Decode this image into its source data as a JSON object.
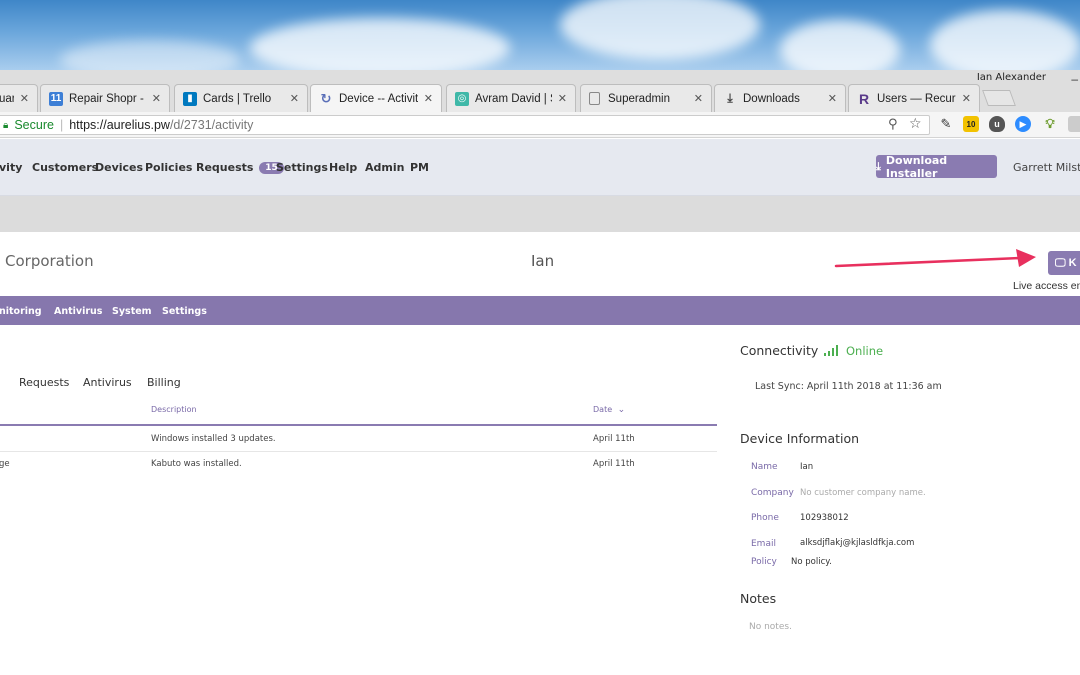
{
  "os": {
    "user_badge": "Ian Alexander",
    "minimize_glyph": "–"
  },
  "browser": {
    "tabs": [
      {
        "title": "uar",
        "icon": "generic-favicon"
      },
      {
        "title": "Repair Shopr - Cal",
        "icon": "calendar-icon"
      },
      {
        "title": "Cards | Trello",
        "icon": "trello-icon"
      },
      {
        "title": "Device -- Activity",
        "icon": "loading-icon"
      },
      {
        "title": "Avram David | Sync",
        "icon": "sync-icon"
      },
      {
        "title": "Superadmin",
        "icon": "document-icon"
      },
      {
        "title": "Downloads",
        "icon": "download-icon"
      },
      {
        "title": "Users — Recurly",
        "icon": "recurly-icon"
      }
    ],
    "address": {
      "secure_label": "Secure",
      "host": "https://aurelius.pw",
      "path": "/d/2731/activity"
    },
    "extension_badge": "10"
  },
  "header": {
    "nav": [
      "vity",
      "Customers",
      "Devices",
      "Policies",
      "Requests",
      "Settings",
      "Help",
      "Admin",
      "PM"
    ],
    "requests_count": "15",
    "download_button": "Download Installer",
    "user_name": "Garrett Milster"
  },
  "device": {
    "org": "Corporation",
    "name": "Ian",
    "remote_button": "K",
    "live_note": "Live access enc"
  },
  "subnav": [
    "nitoring",
    "Antivirus",
    "System",
    "Settings"
  ],
  "content": {
    "tabs": [
      "Requests",
      "Antivirus",
      "Billing"
    ],
    "columns": {
      "description": "Description",
      "date": "Date"
    },
    "rows": [
      {
        "type": "",
        "description": "Windows installed 3 updates.",
        "date": "April 11th"
      },
      {
        "type": "ge",
        "description": "Kabuto was installed.",
        "date": "April 11th"
      }
    ]
  },
  "side": {
    "connectivity_title": "Connectivity",
    "status": "Online",
    "last_sync": "Last Sync: April 11th 2018 at 11:36 am",
    "info_title": "Device Information",
    "info": {
      "name_label": "Name",
      "name_value": "Ian",
      "company_label": "Company",
      "company_value": "No customer company name.",
      "phone_label": "Phone",
      "phone_value": "102938012",
      "email_label": "Email",
      "email_value": "alksdjflakj@kjlasldfkja.com",
      "policy_label": "Policy",
      "policy_value": "No policy."
    },
    "notes_title": "Notes",
    "notes_empty": "No notes."
  },
  "colors": {
    "accent": "#8a7bb1",
    "subnav": "#8677ad",
    "online": "#4caf50",
    "arrow": "#e8305e"
  }
}
